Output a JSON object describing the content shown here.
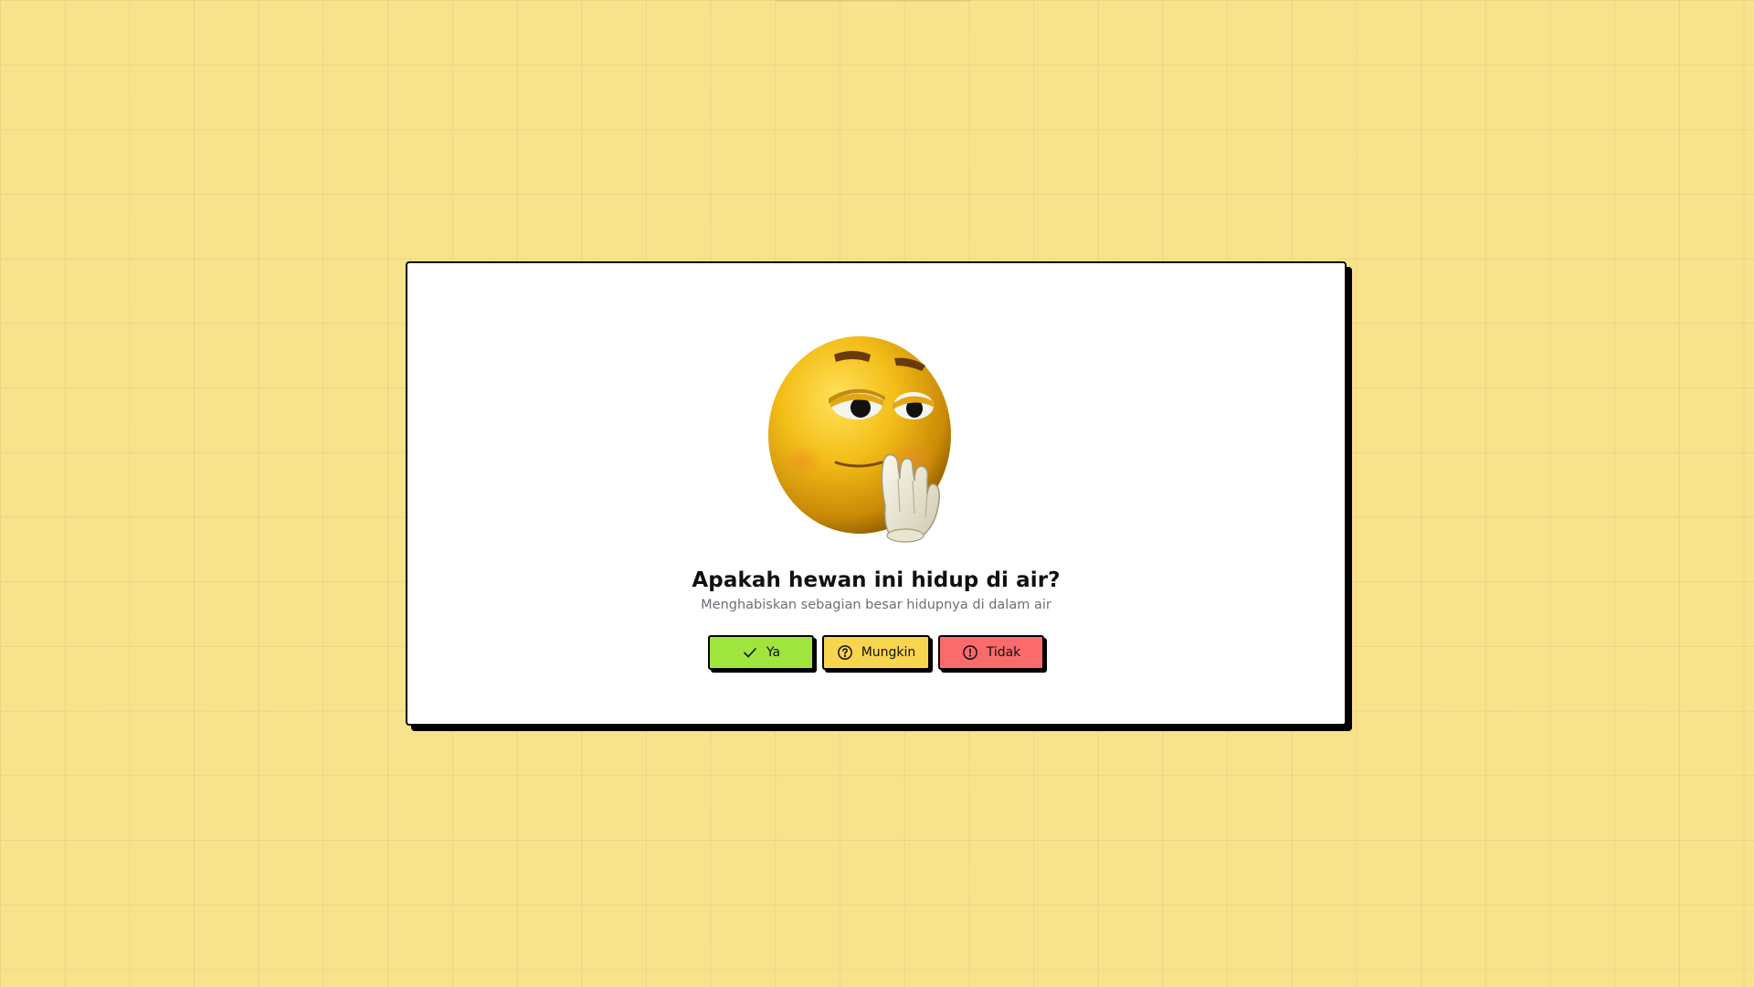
{
  "question": {
    "title": "Apakah hewan ini hidup di air?",
    "hint": "Menghabiskan sebagian besar hidupnya di dalam air"
  },
  "mascot": {
    "icon": "thinking-face-emoji"
  },
  "answers": [
    {
      "label": "Ya",
      "icon": "check-icon",
      "color": "#a0e53e"
    },
    {
      "label": "Mungkin",
      "icon": "question-circle-icon",
      "color": "#f8d54f"
    },
    {
      "label": "Tidak",
      "icon": "alert-circle-icon",
      "color": "#fb6b6b"
    }
  ],
  "colors": {
    "background": "#f8e28c",
    "card": "#ffffff",
    "border": "#000000"
  }
}
